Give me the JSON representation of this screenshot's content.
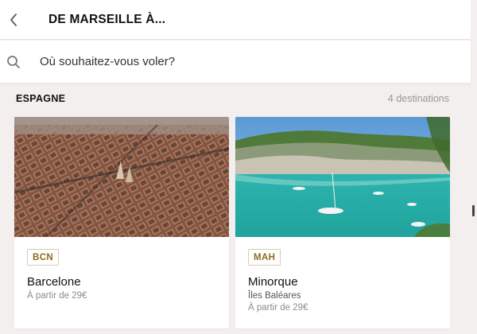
{
  "header": {
    "title": "DE MARSEILLE À..."
  },
  "search": {
    "placeholder": "Où souhaitez-vous voler?"
  },
  "section": {
    "title": "ESPAGNE",
    "count": "4 destinations"
  },
  "cards": [
    {
      "code": "BCN",
      "city": "Barcelone",
      "region": "",
      "price": "À partir de 29€"
    },
    {
      "code": "MAH",
      "city": "Minorque",
      "region": "Îles Baléares",
      "price": "À partir de 29€"
    }
  ],
  "icons": {
    "back": "chevron-left-icon",
    "search": "search-icon"
  },
  "colors": {
    "code_badge_text": "#8d6d1f",
    "background": "#f3efee",
    "muted": "#9a9696"
  }
}
